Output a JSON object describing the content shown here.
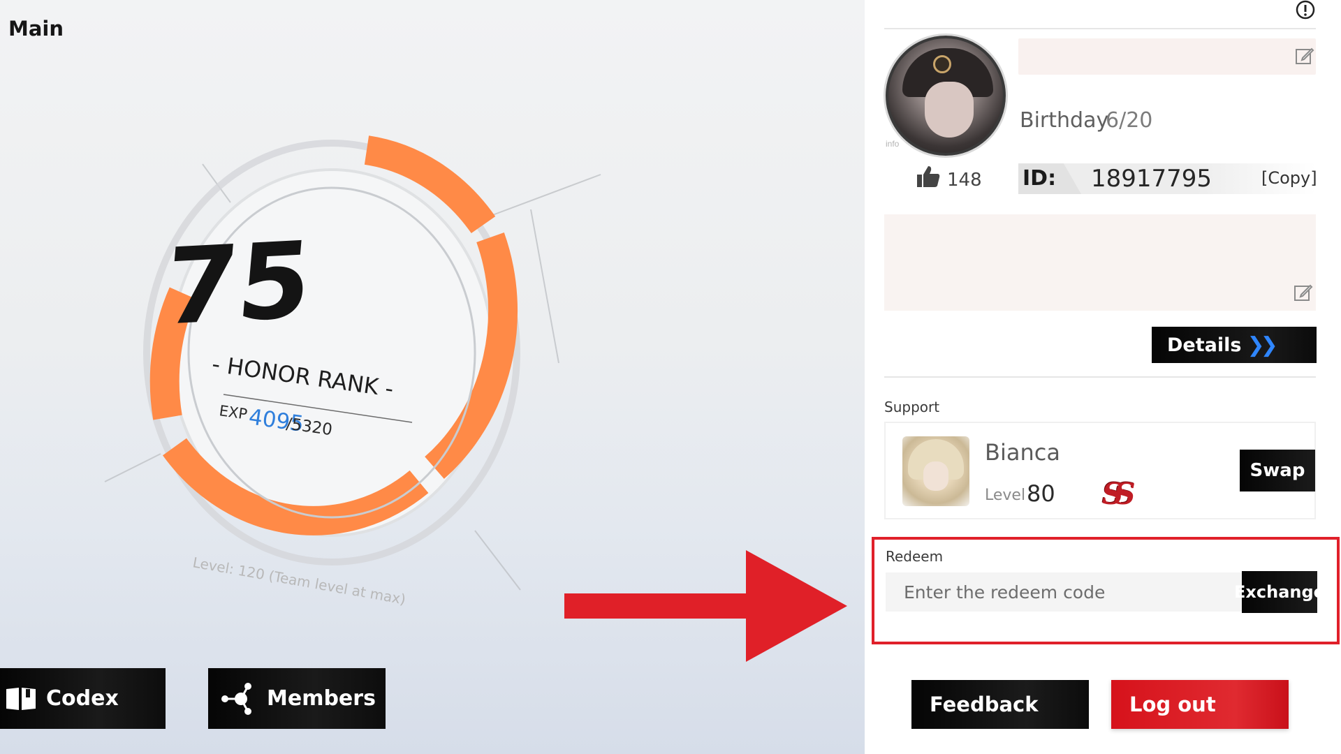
{
  "screen": {
    "title": "Main"
  },
  "honor": {
    "rank": "75",
    "label": "- HONOR RANK -",
    "exp_label": "EXP",
    "exp_current": "4095",
    "exp_max": "/5320",
    "progress": 0.77,
    "level_note": "Level: 120 (Team level at max)",
    "ring_color": "#ff8a47"
  },
  "left_buttons": {
    "codex": {
      "label": "Codex",
      "icon": "book-icon"
    },
    "members": {
      "label": "Members",
      "icon": "network-icon"
    }
  },
  "profile": {
    "avatar_label": "info",
    "birthday_label": "Birthday",
    "birthday_value": "6/20",
    "likes": "148",
    "id_label": "ID:",
    "id_value": "18917795",
    "copy_label": "[Copy]",
    "details_label": "Details",
    "details_chevron": "❯❯"
  },
  "support": {
    "title": "Support",
    "name": "Bianca",
    "level_label": "Level",
    "level_value": "80",
    "rank_badge": "SS",
    "swap_label": "Swap"
  },
  "redeem": {
    "title": "Redeem",
    "placeholder": "Enter the redeem code",
    "exchange_label": "Exchange",
    "highlight_color": "#e0202a"
  },
  "footer": {
    "feedback_label": "Feedback",
    "logout_label": "Log out",
    "logout_color": "#d6121b"
  }
}
